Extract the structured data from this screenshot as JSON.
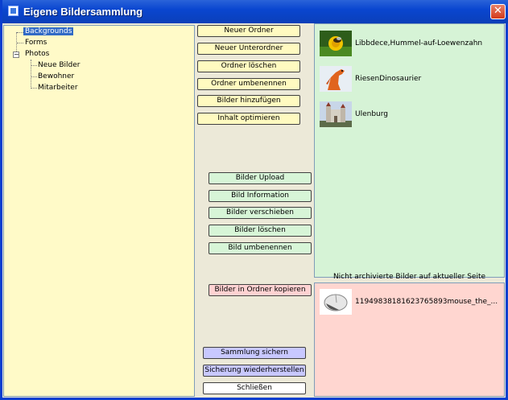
{
  "window": {
    "title": "Eigene Bildersammlung",
    "close_label": "✕"
  },
  "tree": {
    "expander": "−",
    "items": [
      {
        "label": "Backgrounds",
        "selected": true
      },
      {
        "label": "Forms"
      },
      {
        "label": "Photos"
      },
      {
        "label": "Neue Bilder"
      },
      {
        "label": "Bewohner"
      },
      {
        "label": "Mitarbeiter"
      }
    ]
  },
  "folder_buttons": {
    "new_folder": "Neuer Ordner",
    "new_subfolder": "Neuer Unterordner",
    "delete_folder": "Ordner löschen",
    "rename_folder": "Ordner umbenennen",
    "add_images": "Bilder hinzufügen",
    "optimize": "Inhalt optimieren"
  },
  "image_buttons": {
    "upload": "Bilder Upload",
    "info": "Bild Information",
    "move": "Bilder verschieben",
    "delete": "Bilder löschen",
    "rename": "Bild umbenennen"
  },
  "copy_button": "Bilder in Ordner kopieren",
  "footer_buttons": {
    "save": "Sammlung sichern",
    "restore": "Sicherung wiederherstellen",
    "close": "Schließen"
  },
  "images": [
    {
      "name": "Libbdece,Hummel-auf-Loewenzahn",
      "thumb": "bee-on-dandelion"
    },
    {
      "name": "RiesenDinosaurier",
      "thumb": "orange-dinosaur"
    },
    {
      "name": "Ulenburg",
      "thumb": "castle"
    }
  ],
  "unarchived": {
    "caption": "Nicht archivierte Bilder auf aktueller Seite",
    "items": [
      {
        "name": "119498381816237658​93mouse_the_...",
        "thumb": "computer-mouse"
      }
    ]
  },
  "colors": {
    "title_bar": "#0a46d0",
    "tree_bg": "#fffac8",
    "images_bg": "#d6f3d6",
    "unarchived_bg": "#ffd6d0"
  }
}
